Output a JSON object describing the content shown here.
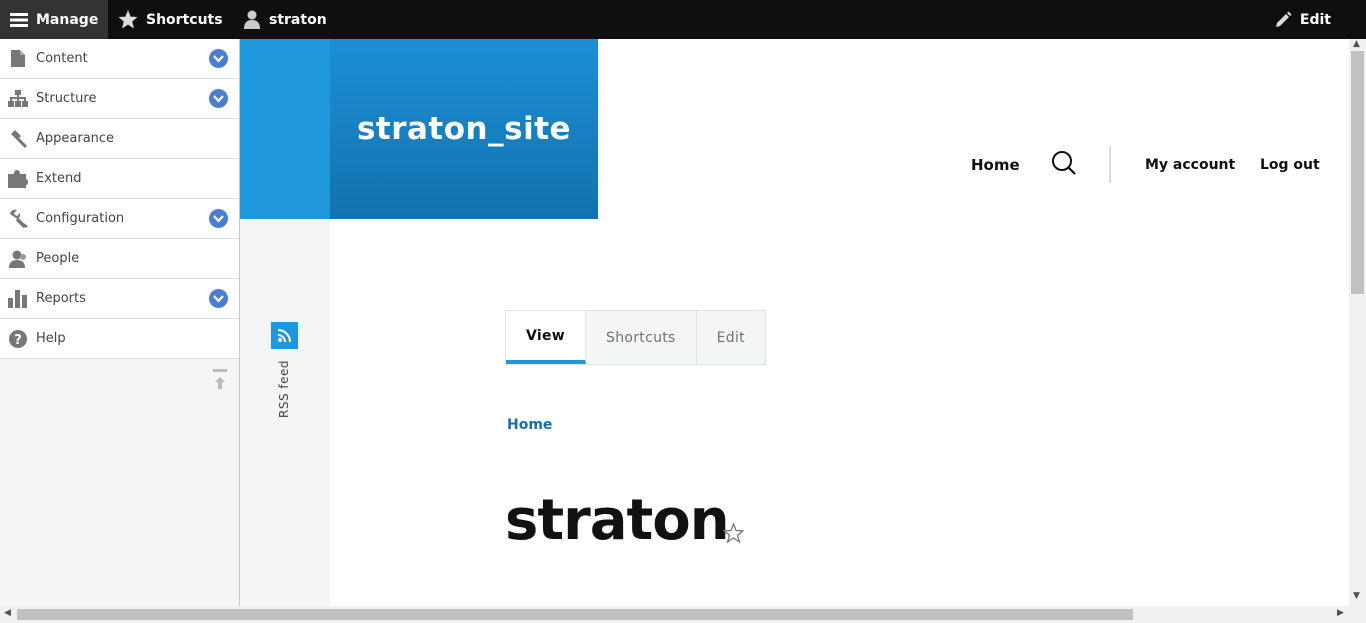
{
  "toolbar": {
    "manage": "Manage",
    "shortcuts": "Shortcuts",
    "user": "straton",
    "edit": "Edit"
  },
  "tray": {
    "items": [
      {
        "label": "Content",
        "icon": "file-icon",
        "expandable": true
      },
      {
        "label": "Structure",
        "icon": "sitemap-icon",
        "expandable": true
      },
      {
        "label": "Appearance",
        "icon": "paintbrush-icon",
        "expandable": false
      },
      {
        "label": "Extend",
        "icon": "puzzle-icon",
        "expandable": false
      },
      {
        "label": "Configuration",
        "icon": "wrench-icon",
        "expandable": true
      },
      {
        "label": "People",
        "icon": "people-icon",
        "expandable": false
      },
      {
        "label": "Reports",
        "icon": "bar-chart-icon",
        "expandable": true
      },
      {
        "label": "Help",
        "icon": "help-icon",
        "expandable": false
      }
    ]
  },
  "site": {
    "name": "straton_site"
  },
  "rss": {
    "label": "RSS feed"
  },
  "nav": {
    "home": "Home",
    "my_account": "My account",
    "log_out": "Log out"
  },
  "tabs": [
    {
      "label": "View",
      "active": true
    },
    {
      "label": "Shortcuts",
      "active": false
    },
    {
      "label": "Edit",
      "active": false
    }
  ],
  "breadcrumb": {
    "home": "Home"
  },
  "page": {
    "title": "straton"
  },
  "colors": {
    "toolbar_bg": "#0f0f0f",
    "brand_blue": "#1e97dd",
    "chevron_blue": "#4a7fcd",
    "link": "#1a6fa8"
  }
}
